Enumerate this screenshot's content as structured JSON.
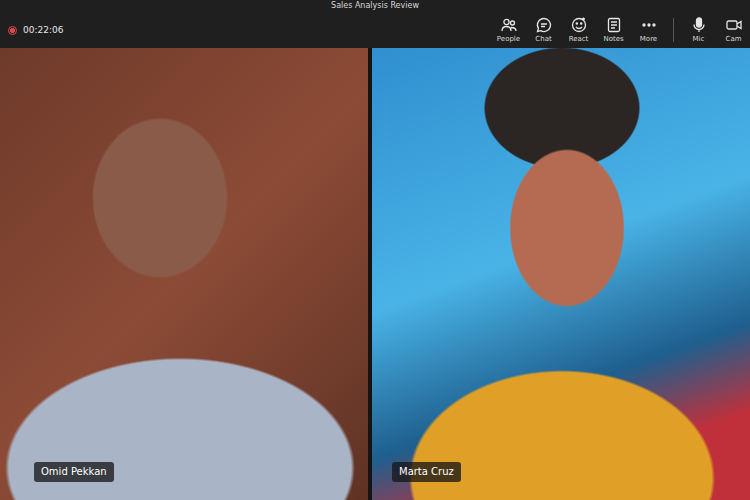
{
  "window": {
    "title": "Sales Analysis Review"
  },
  "meeting": {
    "timer": "00:22:06",
    "recording": true
  },
  "toolbar": [
    {
      "label": "People"
    },
    {
      "label": "Chat"
    },
    {
      "label": "React"
    },
    {
      "label": "Notes"
    },
    {
      "label": "More"
    },
    {
      "label": "Mic"
    },
    {
      "label": "Cam"
    }
  ],
  "participants": [
    {
      "name": "Omid Pekkan",
      "kind": "video"
    },
    {
      "name": "Marta Cruz",
      "kind": "avatar"
    }
  ]
}
